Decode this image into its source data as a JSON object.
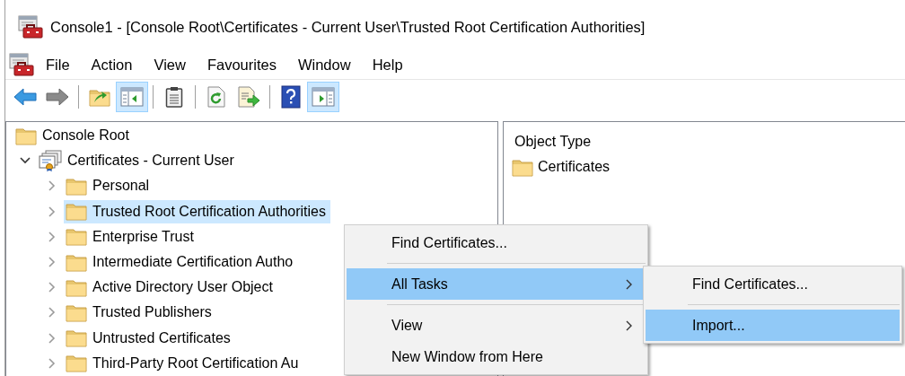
{
  "window": {
    "title": "Console1 - [Console Root\\Certificates - Current User\\Trusted Root Certification Authorities]"
  },
  "menu_bar": [
    "File",
    "Action",
    "View",
    "Favourites",
    "Window",
    "Help"
  ],
  "toolbar": [
    {
      "kind": "back",
      "pressed": false
    },
    {
      "kind": "forward",
      "pressed": false
    },
    {
      "kind": "separator"
    },
    {
      "kind": "up",
      "pressed": false
    },
    {
      "kind": "show_tree",
      "pressed": true
    },
    {
      "kind": "separator"
    },
    {
      "kind": "properties",
      "pressed": false
    },
    {
      "kind": "separator"
    },
    {
      "kind": "refresh",
      "pressed": false
    },
    {
      "kind": "export",
      "pressed": false
    },
    {
      "kind": "separator"
    },
    {
      "kind": "help",
      "pressed": false
    },
    {
      "kind": "action_pane",
      "pressed": true
    }
  ],
  "tree": {
    "items": [
      {
        "label": "Console Root",
        "kind": "root",
        "selected": false,
        "children": [
          {
            "label": "Certificates - Current User",
            "kind": "store",
            "expanded": true,
            "selected": false,
            "children": [
              {
                "label": "Personal",
                "kind": "folder",
                "expanded": false,
                "selected": false
              },
              {
                "label": "Trusted Root Certification Authorities",
                "kind": "folder",
                "expanded": false,
                "selected": true
              },
              {
                "label": "Enterprise Trust",
                "kind": "folder",
                "expanded": false,
                "selected": false
              },
              {
                "label": "Intermediate Certification Autho",
                "kind": "folder",
                "expanded": false,
                "selected": false
              },
              {
                "label": "Active Directory User Object",
                "kind": "folder",
                "expanded": false,
                "selected": false
              },
              {
                "label": "Trusted Publishers",
                "kind": "folder",
                "expanded": false,
                "selected": false
              },
              {
                "label": "Untrusted Certificates",
                "kind": "folder",
                "expanded": false,
                "selected": false
              },
              {
                "label": "Third-Party Root Certification Au",
                "kind": "folder",
                "expanded": false,
                "selected": false
              }
            ]
          }
        ]
      }
    ]
  },
  "details": {
    "columns": [
      "Object Type"
    ],
    "rows": [
      {
        "name": "Certificates"
      }
    ]
  },
  "context_menu": {
    "items": [
      {
        "kind": "item",
        "label": "Find Certificates...",
        "selected": false,
        "submenu": false
      },
      {
        "kind": "separator"
      },
      {
        "kind": "item",
        "label": "All Tasks",
        "selected": true,
        "submenu": true
      },
      {
        "kind": "separator"
      },
      {
        "kind": "item",
        "label": "View",
        "selected": false,
        "submenu": true
      },
      {
        "kind": "item",
        "label": "New Window from Here",
        "selected": false,
        "submenu": false
      }
    ]
  },
  "submenu": {
    "items": [
      {
        "kind": "item",
        "label": "Find Certificates...",
        "selected": false,
        "submenu": false
      },
      {
        "kind": "separator"
      },
      {
        "kind": "item",
        "label": "Import...",
        "selected": true,
        "submenu": false
      }
    ]
  }
}
